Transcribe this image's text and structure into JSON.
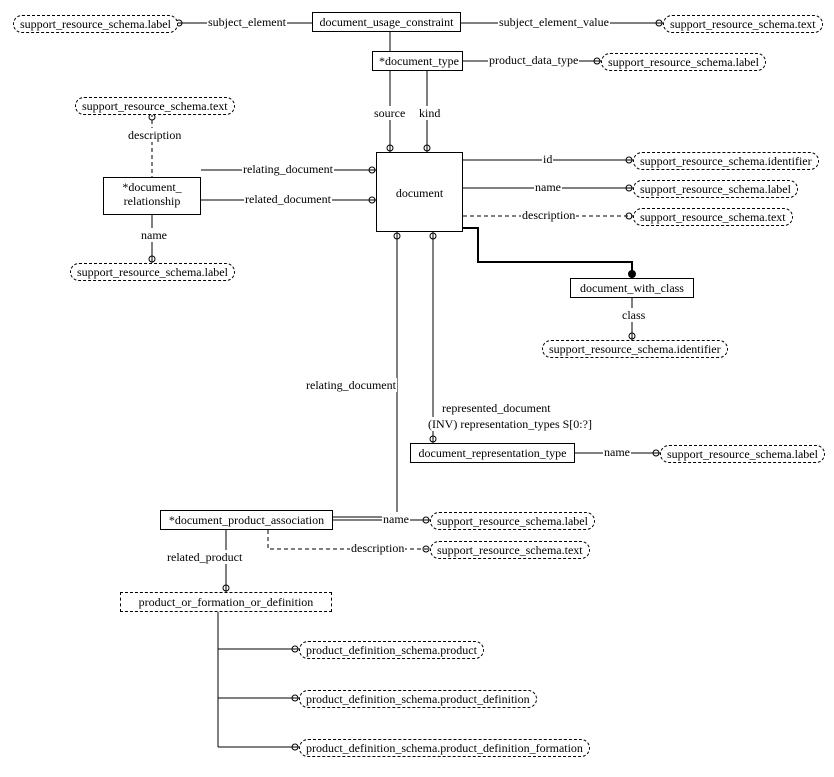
{
  "entities": {
    "document_usage_constraint": "document_usage_constraint",
    "document_type": "*document_type",
    "document": "document",
    "document_relationship": "*document_\nrelationship",
    "document_with_class": "document_with_class",
    "document_representation_type": "document_representation_type",
    "document_product_association": "*document_product_association",
    "product_or_formation_or_definition": "product_or_formation_or_definition"
  },
  "refs": {
    "srs_label": "support_resource_schema.label",
    "srs_text": "support_resource_schema.text",
    "srs_identifier": "support_resource_schema.identifier",
    "pds_product": "product_definition_schema.product",
    "pds_product_definition": "product_definition_schema.product_definition",
    "pds_product_definition_formation": "product_definition_schema.product_definition_formation"
  },
  "labels": {
    "subject_element": "subject_element",
    "subject_element_value": "subject_element_value",
    "product_data_type": "product_data_type",
    "source": "source",
    "kind": "kind",
    "description_rel": "description",
    "relating_document": "relating_document",
    "related_document": "related_document",
    "name_rel": "name",
    "id": "id",
    "name_doc": "name",
    "description_doc": "description",
    "class": "class",
    "relating_document_dpa": "relating_document",
    "represented_document": "represented_document",
    "inv_rep_types": "(INV) representation_types S[0:?]",
    "name_drt": "name",
    "name_dpa": "name",
    "description_dpa": "description",
    "related_product": "related_product"
  }
}
